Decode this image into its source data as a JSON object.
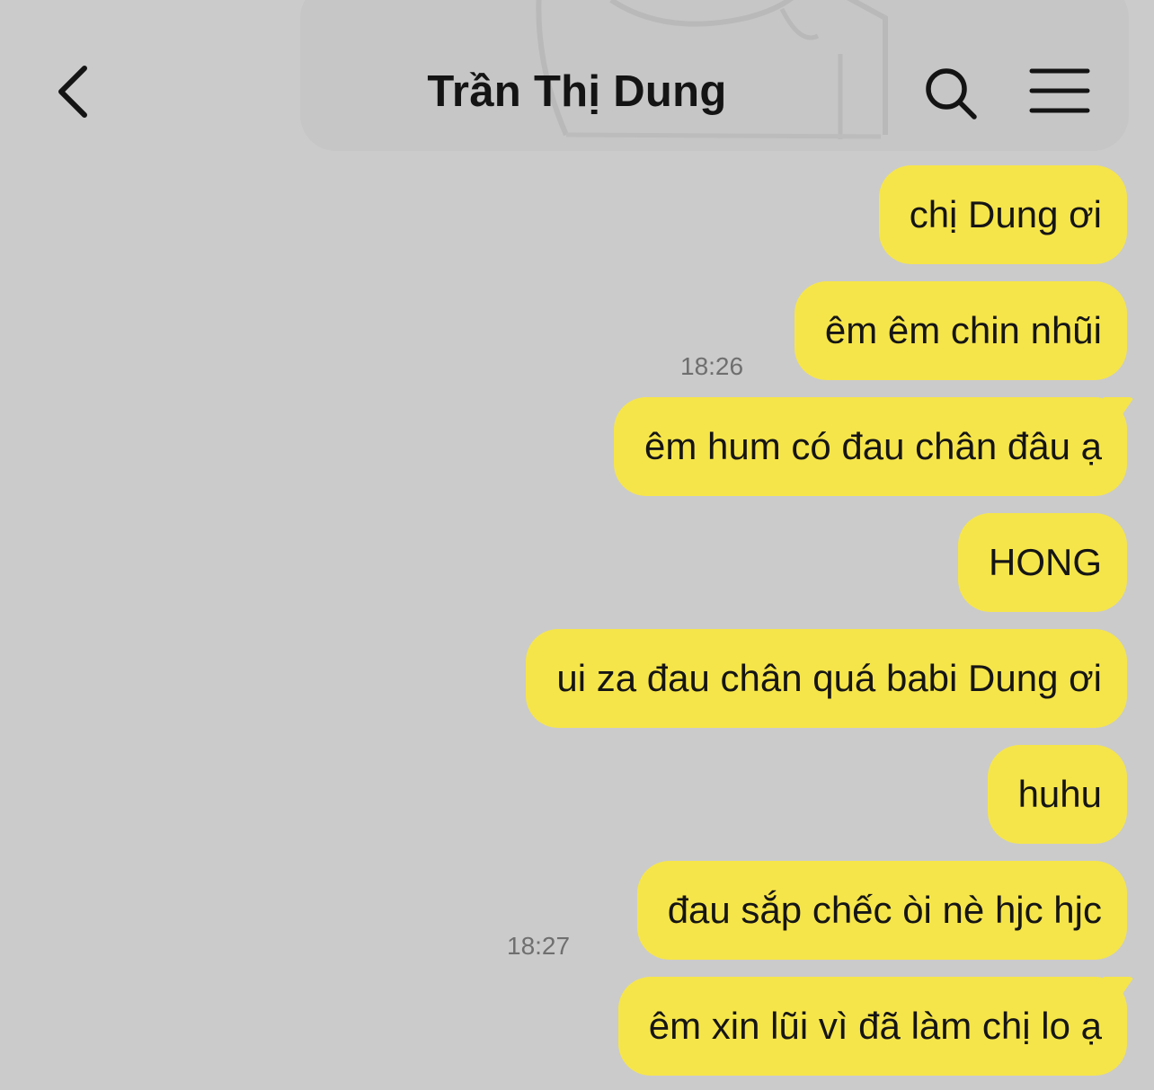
{
  "header": {
    "title": "Trần Thị Dung",
    "back_icon": "chevron-left-icon",
    "search_icon": "search-icon",
    "menu_icon": "hamburger-menu-icon"
  },
  "colors": {
    "background": "#cbcbcb",
    "bubble": "#f6e54a",
    "text": "#151515",
    "timestamp": "#6f6f6f"
  },
  "messages": [
    {
      "text": "chị Dung ơi"
    },
    {
      "text": "êm êm chin nhũi"
    },
    {
      "text": "êm hum có đau chân đâu ạ"
    },
    {
      "text": "HONG"
    },
    {
      "text": "ui za đau chân quá babi Dung ơi"
    },
    {
      "text": "huhu"
    },
    {
      "text": "đau sắp chếc òi nè hjc hjc"
    },
    {
      "text": "êm xin lũi vì đã làm chị lo ạ"
    }
  ],
  "timestamps": {
    "first": "18:26",
    "second": "18:27"
  }
}
